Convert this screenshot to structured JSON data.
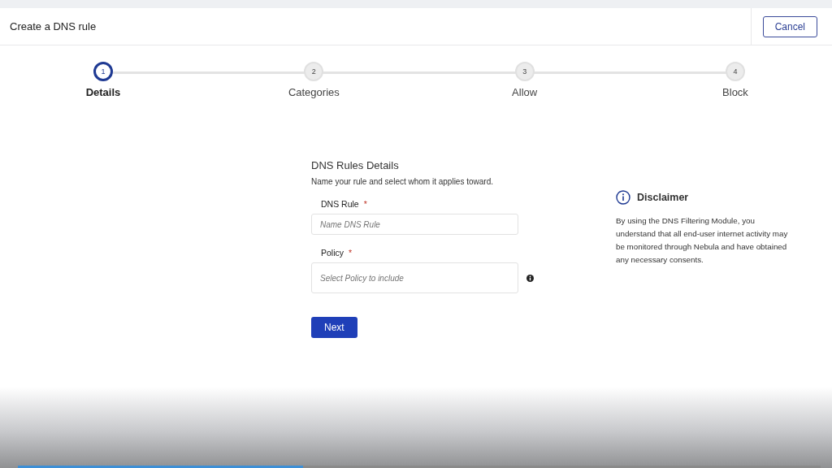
{
  "header": {
    "title": "Create a DNS rule",
    "cancel": "Cancel"
  },
  "steps": [
    {
      "number": "1",
      "label": "Details",
      "selected": true
    },
    {
      "number": "2",
      "label": "Categories",
      "selected": false
    },
    {
      "number": "3",
      "label": "Allow",
      "selected": false
    },
    {
      "number": "4",
      "label": "Block",
      "selected": false
    }
  ],
  "form": {
    "heading": "DNS Rules Details",
    "subtitle": "Name your rule and select whom it applies toward.",
    "fields": [
      {
        "label": "DNS Rule",
        "required": "*",
        "placeholder": "Name DNS Rule",
        "kind": "text"
      },
      {
        "label": "Policy",
        "required": "*",
        "placeholder": "Select Policy to include",
        "kind": "select"
      }
    ],
    "next": "Next"
  },
  "disclaimer": {
    "title": "Disclaimer",
    "text": "By using the DNS Filtering Module, you understand that all end-user internet activity may be monitored through Nebula and have obtained any necessary consents."
  },
  "video_progress": {
    "level": 0.355
  }
}
